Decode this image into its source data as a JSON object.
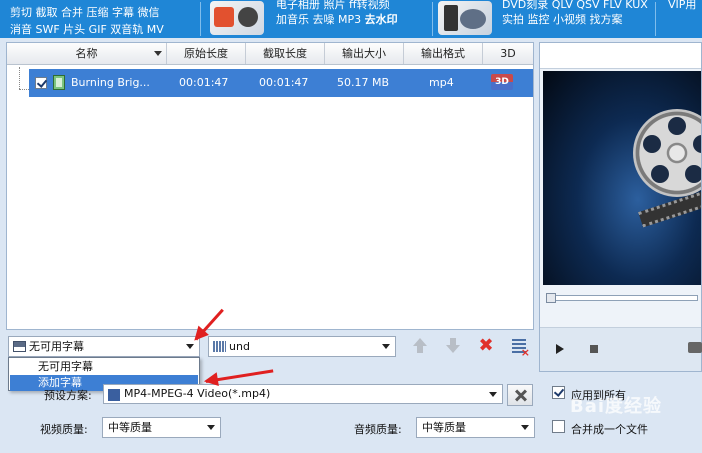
{
  "promo": {
    "group1": {
      "line1": "剪切 截取 合并 压缩 字幕 微信",
      "line2": "消音 SWF 片头 GIF 双音轨 MV"
    },
    "group2": {
      "line1": "电子相册 照片 ff转视频",
      "line2_normal": "加音乐 去噪 MP3 ",
      "line2_bold": "去水印"
    },
    "group3": {
      "line1": "DVD刻录 QLV QSV FLV KUX",
      "line2": "实拍 监控 小视频 找方案"
    },
    "group4": {
      "line1": "VIP用"
    }
  },
  "file_list": {
    "columns": [
      "名称",
      "原始长度",
      "截取长度",
      "输出大小",
      "输出格式",
      "3D"
    ],
    "rows": [
      {
        "name": "Burning Brig...",
        "original_length": "00:01:47",
        "cut_length": "00:01:47",
        "output_size": "50.17 MB",
        "output_format": "mp4",
        "3d": "3D"
      }
    ]
  },
  "subtitle": {
    "selected": "无可用字幕",
    "options": [
      "无可用字幕",
      "添加字幕"
    ],
    "selected_option_index": 1
  },
  "audio": {
    "selected": "und"
  },
  "settings": {
    "preset_label": "预设方案:",
    "preset_value": "MP4-MPEG-4 Video(*.mp4)",
    "apply_all_label": "应用到所有",
    "video_quality_label": "视频质量:",
    "video_quality_value": "中等质量",
    "audio_quality_label": "音频质量:",
    "audio_quality_value": "中等质量",
    "merge_label": "合并成一个文件"
  },
  "watermark_text": "Bai度经验",
  "colors": {
    "accent": "#3d7fd4",
    "top_bar": "#1f86d6",
    "annotation": "#e02020",
    "delete": "#e0312b"
  }
}
